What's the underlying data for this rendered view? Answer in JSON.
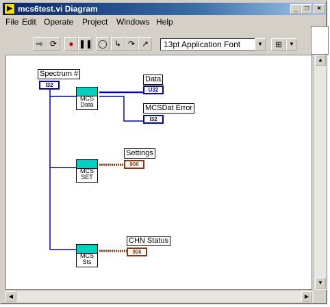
{
  "window": {
    "title": "mcs6test.vi Diagram",
    "app_icon": "labview-vi-icon"
  },
  "menu": [
    {
      "label": "File",
      "accel": "F"
    },
    {
      "label": "Edit",
      "accel": "E"
    },
    {
      "label": "Operate",
      "accel": "O"
    },
    {
      "label": "Project",
      "accel": "P"
    },
    {
      "label": "Windows",
      "accel": "W"
    },
    {
      "label": "Help",
      "accel": "H"
    }
  ],
  "toolbar": {
    "font": "13pt Application Font"
  },
  "diagram": {
    "labels": {
      "spectrum": "Spectrum #",
      "data": "Data",
      "mcsdat_error": "MCSDat Error",
      "settings": "Settings",
      "chn_status": "CHN Status"
    },
    "terminals": {
      "spectrum": "I32",
      "data": "U32",
      "mcsdat_error": "I32",
      "settings": "906",
      "chn_status": "906"
    },
    "subvis": {
      "data": [
        "MCS",
        "Data"
      ],
      "set": [
        "MCS",
        "SET"
      ],
      "sts": [
        "MCS",
        "Sts"
      ]
    }
  },
  "colors": {
    "wire_int": "#0000c0",
    "wire_cluster": "#8b3a0f",
    "titlebar": "#0a246a"
  }
}
